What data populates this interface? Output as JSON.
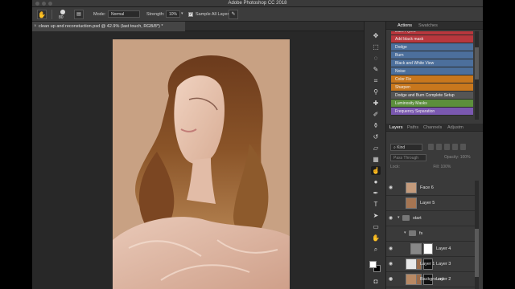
{
  "window": {
    "title": "Adobe Photoshop CC 2018"
  },
  "options_bar": {
    "brush_size": "80",
    "mode_label": "Mode:",
    "mode_value": "Normal",
    "strength_label": "Strength:",
    "strength_value": "10%",
    "sample_all_label": "Sample All Layers"
  },
  "document": {
    "tab_title": "clean up and reconstuction.psd @ 42.9% (last touch, RGB/8*) *"
  },
  "actions_panel": {
    "tabs": [
      "Actions",
      "Swatches"
    ],
    "items": [
      {
        "label": "Dark Flyers",
        "color": "#b8373d"
      },
      {
        "label": "Add black mask",
        "color": "#b8373d"
      },
      {
        "label": "Dodge",
        "color": "#4c6f9c"
      },
      {
        "label": "Burn",
        "color": "#4c6f9c"
      },
      {
        "label": "Black and White View",
        "color": "#4c6f9c"
      },
      {
        "label": "Noise",
        "color": "#4c6f9c"
      },
      {
        "label": "Color Fix",
        "color": "#c8771d"
      },
      {
        "label": "Sharpen",
        "color": "#c8771d"
      },
      {
        "label": "Dodge and Burn Complete Setup",
        "color": "#555555"
      },
      {
        "label": "Luminosity Masks",
        "color": "#5c8f3c"
      },
      {
        "label": "Frequency Separation",
        "color": "#7a58b0"
      }
    ]
  },
  "layers_panel": {
    "tabs": [
      "Layers",
      "Paths",
      "Channels",
      "Adjustm"
    ],
    "kind_label": "Kind",
    "blend_mode": "Pass Through",
    "opacity_label": "Opacity:",
    "opacity_value": "100%",
    "lock_label": "Lock:",
    "fill_label": "Fill:",
    "fill_value": "100%",
    "layers": [
      {
        "name": "Face 6",
        "type": "layer"
      },
      {
        "name": "Layer 5",
        "type": "layer"
      },
      {
        "name": "start",
        "type": "group"
      },
      {
        "name": "fs",
        "type": "group"
      },
      {
        "name": "Layer 4",
        "type": "layer"
      },
      {
        "name": "Layer 3",
        "type": "layer"
      },
      {
        "name": "Layer 2",
        "type": "layer"
      },
      {
        "name": "Layer 1",
        "type": "layer"
      },
      {
        "name": "Background",
        "type": "layer"
      }
    ]
  }
}
